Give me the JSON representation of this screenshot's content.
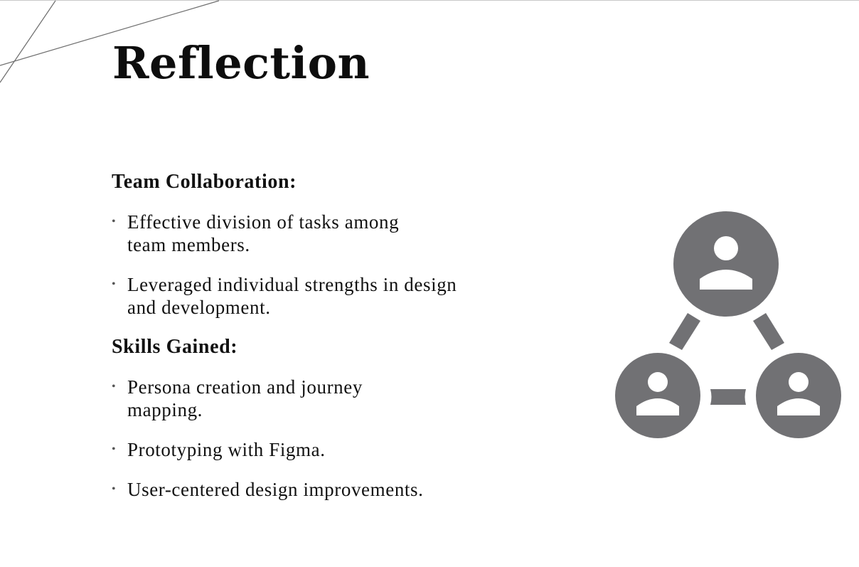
{
  "slide": {
    "title": "Reflection",
    "sections": [
      {
        "heading": "Team Collaboration:",
        "items": [
          "Effective division of tasks among team members.",
          "Leveraged individual strengths in design and development."
        ]
      },
      {
        "heading": "Skills Gained:",
        "items": [
          "Persona creation and journey mapping.",
          "Prototyping with Figma.",
          "User-centered design improvements."
        ]
      }
    ],
    "bullet_glyph": "•",
    "icon": {
      "name": "team-network-icon",
      "color": "#717174"
    }
  }
}
